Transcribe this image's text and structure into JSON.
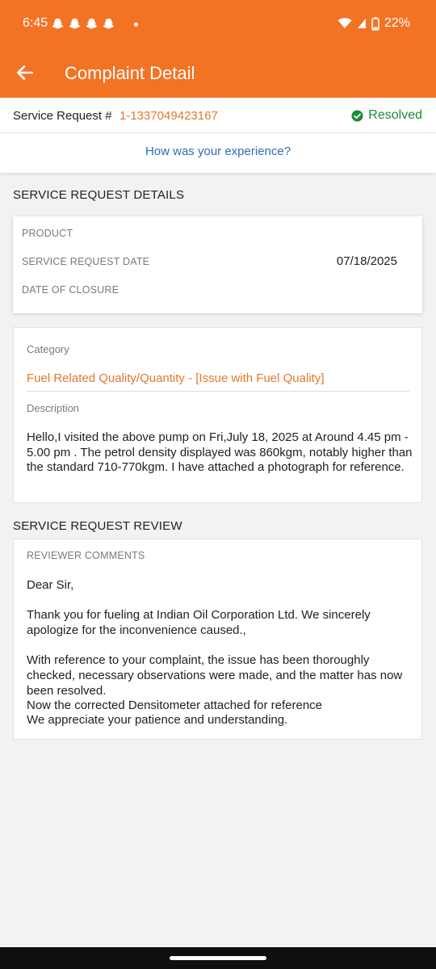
{
  "status_bar": {
    "time": "6:45",
    "notification_icons": [
      "snapchat-ghost-icon",
      "snapchat-ghost-icon",
      "snapchat-ghost-icon",
      "snapchat-ghost-icon"
    ],
    "battery": "22%"
  },
  "app_bar": {
    "title": "Complaint Detail",
    "back_icon": "arrow-left-icon"
  },
  "service_request": {
    "label": "Service Request #",
    "number": "1-1337049423167",
    "status": "Resolved",
    "status_icon": "check-circle-icon"
  },
  "experience_link": "How was your experience?",
  "details_section": {
    "heading": "SERVICE REQUEST DETAILS",
    "fields": [
      {
        "label": "PRODUCT",
        "value": ""
      },
      {
        "label": "SERVICE REQUEST DATE",
        "value": "07/18/2025"
      },
      {
        "label": "DATE OF CLOSURE",
        "value": ""
      }
    ]
  },
  "category_card": {
    "category_label": "Category",
    "category_value": "Fuel Related Quality/Quantity - [Issue with Fuel Quality]",
    "description_label": "Description",
    "description": "Hello,I visited the above pump on Fri,July 18, 2025 at Around 4.45 pm - 5.00 pm . The petrol density displayed was 860kgm, notably higher than the standard 710-770kgm. I have attached a photograph for reference."
  },
  "review_section": {
    "heading": "SERVICE REQUEST REVIEW",
    "comments_label": "REVIEWER COMMENTS",
    "greeting": "Dear Sir,",
    "paragraph1": "Thank you for fueling at Indian Oil Corporation Ltd. We sincerely apologize for the inconvenience caused.,",
    "paragraph2": "With reference to your complaint, the issue has been thoroughly checked, necessary observations were made, and the matter has now been resolved.",
    "line3": "Now the corrected Densitometer attached for reference",
    "line4": "We appreciate your patience and understanding."
  },
  "colors": {
    "brand_orange": "#f37325",
    "link_orange": "#e07a2f",
    "link_blue": "#2e6db5",
    "status_green": "#1d8a3a"
  }
}
